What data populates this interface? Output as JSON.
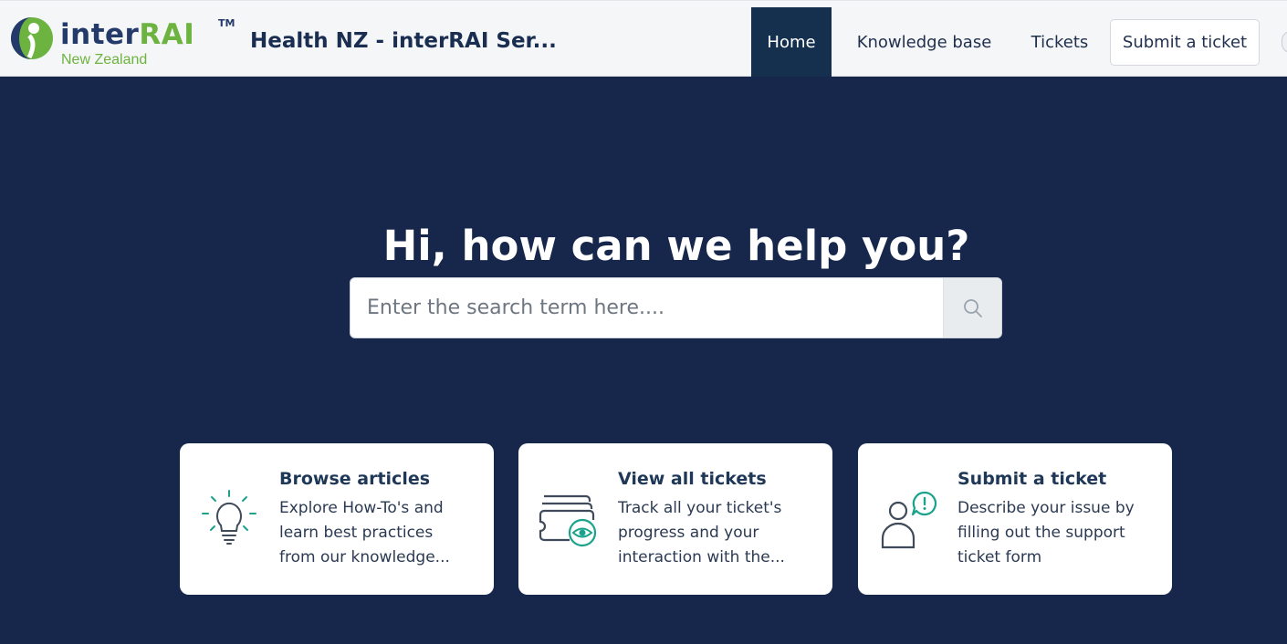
{
  "brand": {
    "logo_word_1": "inter",
    "logo_word_2": "RAI",
    "logo_tm": "TM",
    "logo_sub": "New Zealand",
    "site_title": "Health NZ - interRAI Ser...",
    "colors": {
      "navy": "#233a6a",
      "green": "#6db33f",
      "teal": "#1aa38a"
    }
  },
  "nav": {
    "home": "Home",
    "knowledge_base": "Knowledge base",
    "tickets": "Tickets",
    "submit": "Submit a ticket",
    "active": "Home"
  },
  "hero": {
    "title": "Hi, how can we help you?",
    "search_placeholder": "Enter the search term here....",
    "search_icon": "search-icon"
  },
  "cards": [
    {
      "title": "Browse articles",
      "desc_lines": [
        "Explore How-To's and",
        "learn best practices",
        "from our knowledge..."
      ],
      "icon": "lightbulb-icon"
    },
    {
      "title": "View all tickets",
      "desc_lines": [
        "Track all your ticket's",
        "progress and your",
        "interaction with the..."
      ],
      "icon": "tickets-view-icon"
    },
    {
      "title": "Submit a ticket",
      "desc_lines": [
        "Describe your issue by",
        "filling out the support",
        "ticket form"
      ],
      "icon": "person-alert-icon"
    }
  ]
}
